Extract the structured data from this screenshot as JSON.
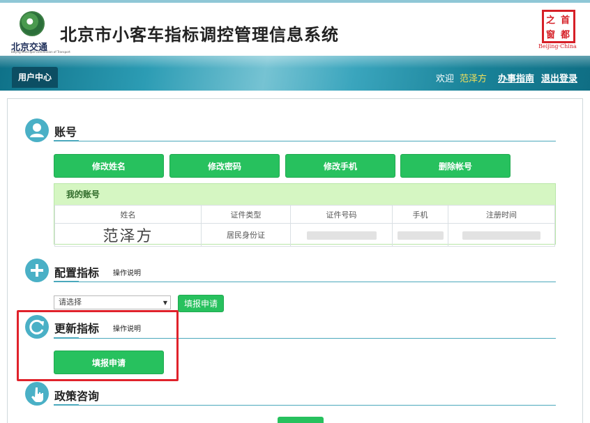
{
  "header": {
    "logo_text": "北京交通",
    "logo_subtext": "Beijing Municipal Commission of Transport",
    "title": "北京市小客车指标调控管理信息系统",
    "seal_chars": [
      "之",
      "首",
      "窗",
      "都"
    ],
    "seal_caption": "Beijing·China"
  },
  "nav": {
    "user_center": "用户中心",
    "welcome": "欢迎",
    "username": "范泽方",
    "guide": "办事指南",
    "logout": "退出登录"
  },
  "account": {
    "title": "账号",
    "buttons": [
      "修改姓名",
      "修改密码",
      "修改手机",
      "删除帐号"
    ],
    "box_title": "我的账号",
    "columns": [
      "姓名",
      "证件类型",
      "证件号码",
      "手机",
      "注册时间"
    ],
    "row": {
      "name": "范泽方",
      "id_type": "居民身份证"
    }
  },
  "config": {
    "title": "配置指标",
    "help": "操作说明",
    "select_value": "请选择",
    "submit": "填报申请"
  },
  "update": {
    "title": "更新指标",
    "help": "操作说明",
    "submit": "填报申请"
  },
  "policy": {
    "title": "政策咨询"
  },
  "colors": {
    "accent_green": "#27c15e",
    "teal": "#4ab0c6",
    "highlight_red": "#e0222b",
    "username_yellow": "#f4e15a"
  }
}
